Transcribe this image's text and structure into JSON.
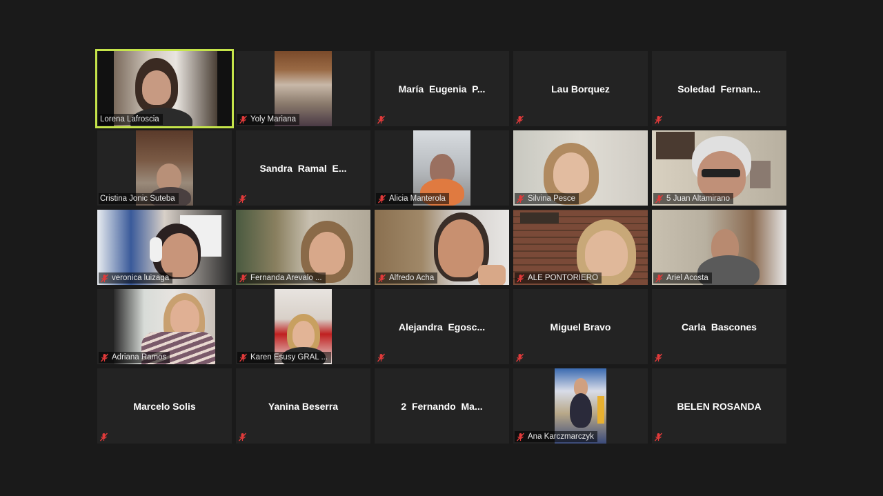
{
  "meeting": {
    "participants": [
      {
        "name": "Lorena Lafroscia",
        "video": true,
        "muted": false,
        "active_speaker": true
      },
      {
        "name": "Yoly Mariana",
        "video": true,
        "muted": true
      },
      {
        "name": "María  Eugenia  P...",
        "video": false,
        "muted": true
      },
      {
        "name": "Lau Borquez",
        "video": false,
        "muted": true
      },
      {
        "name": "Soledad  Fernan...",
        "video": false,
        "muted": true
      },
      {
        "name": "Cristina Jonic Suteba",
        "video": true,
        "muted": false
      },
      {
        "name": "Sandra  Ramal  E...",
        "video": false,
        "muted": true
      },
      {
        "name": "Alicia Manterola",
        "video": true,
        "muted": true
      },
      {
        "name": "Silvina Pesce",
        "video": true,
        "muted": true
      },
      {
        "name": "5 Juan Altamirano",
        "video": true,
        "muted": true
      },
      {
        "name": "veronica luizaga",
        "video": true,
        "muted": true
      },
      {
        "name": "Fernanda Arevalo ...",
        "video": true,
        "muted": true
      },
      {
        "name": "Alfredo Acha",
        "video": true,
        "muted": true
      },
      {
        "name": "ALE PONTORIERO",
        "video": true,
        "muted": true
      },
      {
        "name": "Ariel Acosta",
        "video": true,
        "muted": true
      },
      {
        "name": "Adriana Ramos",
        "video": true,
        "muted": true
      },
      {
        "name": "Karen Esusy GRAL ...",
        "video": true,
        "muted": true
      },
      {
        "name": "Alejandra  Egosc...",
        "video": false,
        "muted": true
      },
      {
        "name": "Miguel Bravo",
        "video": false,
        "muted": true
      },
      {
        "name": "Carla  Bascones",
        "video": false,
        "muted": true
      },
      {
        "name": "Marcelo Solis",
        "video": false,
        "muted": true
      },
      {
        "name": "Yanina Beserra",
        "video": false,
        "muted": true
      },
      {
        "name": "2  Fernando  Ma...",
        "video": false,
        "muted": true
      },
      {
        "name": "Ana Karczmarczyk",
        "video": true,
        "muted": true
      },
      {
        "name": "BELEN ROSANDA",
        "video": false,
        "muted": true
      }
    ]
  },
  "icons": {
    "muted": "muted-mic-icon"
  },
  "colors": {
    "background": "#1a1a1a",
    "tile": "#232323",
    "active_speaker_border": "#c5e44a",
    "mute_icon": "#e03a3a"
  }
}
